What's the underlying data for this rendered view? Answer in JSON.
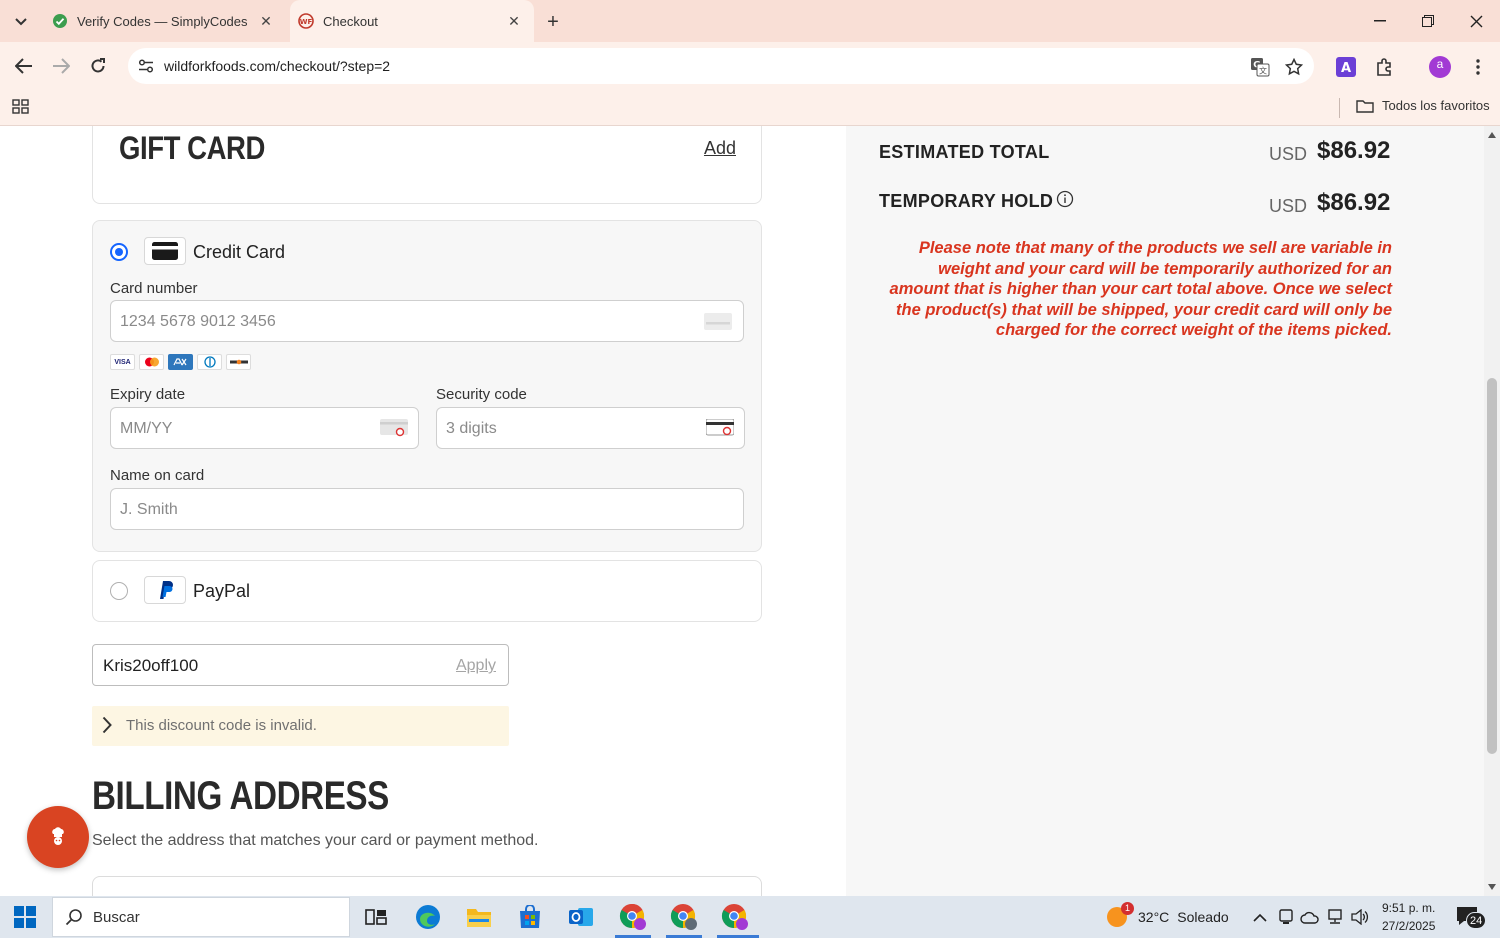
{
  "browser": {
    "tabs": [
      {
        "title": "Verify Codes — SimplyCodes",
        "active": false
      },
      {
        "title": "Checkout",
        "active": true
      }
    ],
    "url": "wildforkfoods.com/checkout/?step=2",
    "bookmarks_all": "Todos los favoritos",
    "profile_initial": "a"
  },
  "gift_card": {
    "title": "GIFT CARD",
    "add_label": "Add"
  },
  "payment": {
    "credit_card_label": "Credit Card",
    "card_number_label": "Card number",
    "card_number_placeholder": "1234 5678 9012 3456",
    "expiry_label": "Expiry date",
    "expiry_placeholder": "MM/YY",
    "security_label": "Security code",
    "security_placeholder": "3 digits",
    "name_label": "Name on card",
    "name_placeholder": "J. Smith",
    "paypal_label": "PayPal",
    "card_brands": [
      "VISA",
      "MC",
      "AMEX",
      "DINERS",
      "DISCOVER"
    ]
  },
  "discount": {
    "value": "Kris20off100",
    "apply_label": "Apply",
    "error": "This discount code is invalid."
  },
  "billing": {
    "title": "BILLING ADDRESS",
    "subtitle": "Select the address that matches your card or payment method."
  },
  "summary": {
    "estimated_total_label": "ESTIMATED TOTAL",
    "estimated_total_currency": "USD",
    "estimated_total_value": "$86.92",
    "temporary_hold_label": "TEMPORARY HOLD",
    "temporary_hold_currency": "USD",
    "temporary_hold_value": "$86.92",
    "note": "Please note that many of the products we sell are variable in weight and your card will be temporarily authorized for an amount that is higher than your cart total above. Once we select the product(s) that will be shipped, your credit card will only be charged for the correct weight of the items picked."
  },
  "taskbar": {
    "search_label": "Buscar",
    "weather_badge": "1",
    "weather_temp": "32°C",
    "weather_desc": "Soleado",
    "time": "9:51 p. m.",
    "date": "27/2/2025",
    "notifications": "24"
  },
  "colors": {
    "accent_blue": "#1565ff",
    "note_red": "#d9351f",
    "chat_orange": "#d94422",
    "tabbar_bg": "#f9dfd6"
  }
}
